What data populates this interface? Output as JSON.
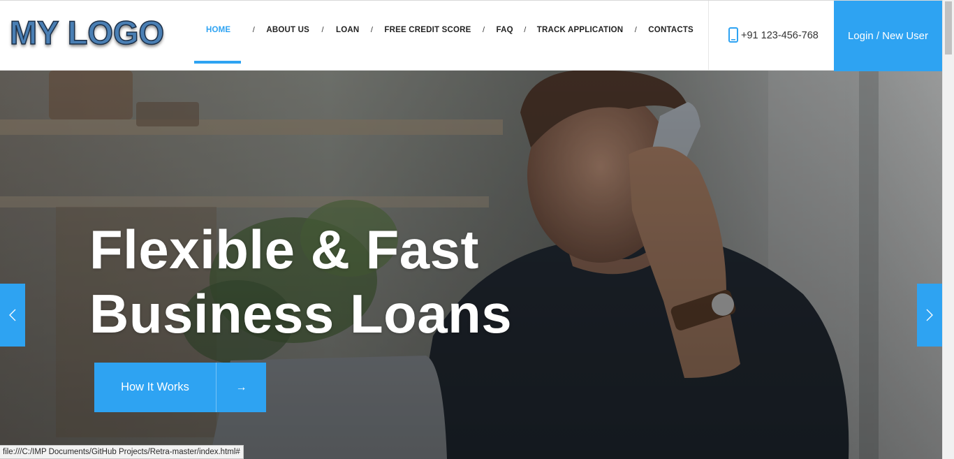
{
  "logo": {
    "text": "MY LOGO"
  },
  "nav": {
    "items": [
      {
        "label": "HOME"
      },
      {
        "label": "ABOUT US"
      },
      {
        "label": "LOAN"
      },
      {
        "label": "FREE CREDIT SCORE"
      },
      {
        "label": "FAQ"
      },
      {
        "label": "TRACK APPLICATION"
      },
      {
        "label": "CONTACTS"
      }
    ],
    "separator": "/",
    "active_index": 0
  },
  "header": {
    "phone": "+91 123-456-768",
    "login_label": "Login / New User"
  },
  "hero": {
    "title_line1": "Flexible & Fast",
    "title_line2": "Business Loans",
    "cta_label": "How It Works",
    "cta_arrow": "→",
    "prev_icon": "chevron-left-icon",
    "next_icon": "chevron-right-icon"
  },
  "status_bar": {
    "url": "file:///C:/IMP Documents/GitHub Projects/Retra-master/index.html#"
  },
  "colors": {
    "accent": "#2ea3f2",
    "nav_text": "#222222",
    "hero_text": "#ffffff"
  }
}
